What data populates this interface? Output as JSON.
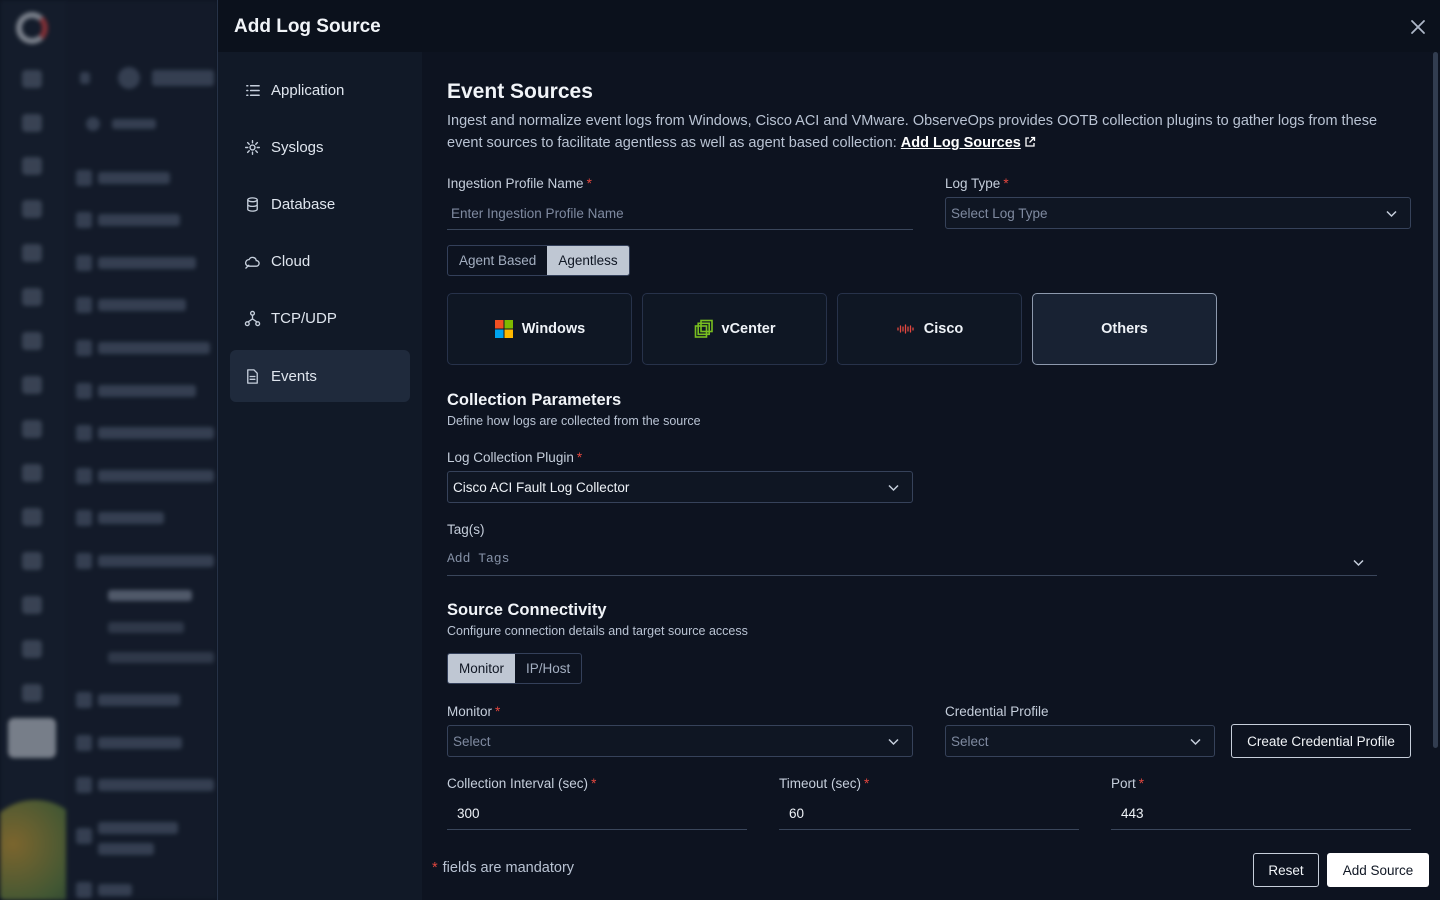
{
  "modal": {
    "title": "Add Log Source"
  },
  "sidebar": {
    "items": [
      {
        "label": "Application",
        "icon": "list-icon"
      },
      {
        "label": "Syslogs",
        "icon": "gear-icon"
      },
      {
        "label": "Database",
        "icon": "database-icon"
      },
      {
        "label": "Cloud",
        "icon": "cloud-icon"
      },
      {
        "label": "TCP/UDP",
        "icon": "network-icon"
      },
      {
        "label": "Events",
        "icon": "document-icon",
        "active": true
      }
    ]
  },
  "event_sources": {
    "title": "Event Sources",
    "description": "Ingest and normalize event logs from Windows, Cisco ACI and VMware. ObserveOps provides OOTB collection plugins to gather logs from these event sources to facilitate agentless as well as agent based collection: ",
    "link_label": "Add Log Sources"
  },
  "form": {
    "ingestion_profile": {
      "label": "Ingestion Profile Name",
      "placeholder": "Enter Ingestion Profile Name"
    },
    "log_type": {
      "label": "Log Type",
      "placeholder": "Select Log Type"
    },
    "collection_mode": {
      "options": [
        "Agent Based",
        "Agentless"
      ],
      "selected": "Agentless"
    },
    "source_cards": [
      {
        "label": "Windows",
        "icon": "windows-icon"
      },
      {
        "label": "vCenter",
        "icon": "vcenter-icon"
      },
      {
        "label": "Cisco",
        "icon": "cisco-icon"
      },
      {
        "label": "Others",
        "icon": "",
        "active": true
      }
    ]
  },
  "collection_parameters": {
    "title": "Collection Parameters",
    "subtitle": "Define how logs are collected from the source",
    "plugin": {
      "label": "Log Collection Plugin",
      "value": "Cisco ACI Fault Log Collector"
    },
    "tags": {
      "label": "Tag(s)",
      "placeholder": "Add Tags"
    }
  },
  "source_connectivity": {
    "title": "Source Connectivity",
    "subtitle": "Configure connection details and target source access",
    "target_mode": {
      "options": [
        "Monitor",
        "IP/Host"
      ],
      "selected": "Monitor"
    },
    "monitor": {
      "label": "Monitor",
      "placeholder": "Select"
    },
    "credential_profile": {
      "label": "Credential Profile",
      "placeholder": "Select"
    },
    "create_credential_label": "Create Credential Profile",
    "collection_interval": {
      "label": "Collection Interval (sec)",
      "value": "300"
    },
    "timeout": {
      "label": "Timeout (sec)",
      "value": "60"
    },
    "port": {
      "label": "Port",
      "value": "443"
    }
  },
  "footer": {
    "required_mark": "*",
    "mandatory_note": "fields are mandatory",
    "reset_label": "Reset",
    "submit_label": "Add Source"
  },
  "colors": {
    "background": "#0d1320",
    "required": "#e2473f",
    "accent_active": "#bfc7d3"
  }
}
